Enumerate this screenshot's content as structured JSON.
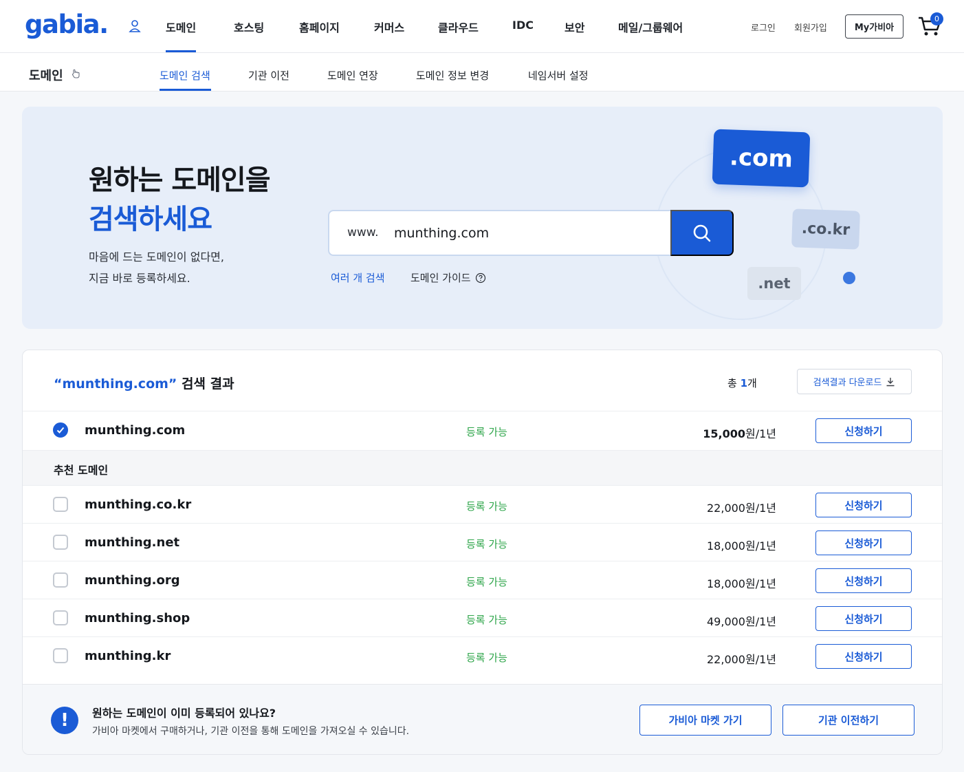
{
  "header": {
    "logo": "gabia.",
    "menu": [
      "도메인",
      "호스팅",
      "홈페이지",
      "커머스",
      "클라우드",
      "IDC",
      "보안",
      "메일/그룹웨어"
    ],
    "login": "로그인",
    "signup": "회원가입",
    "mygabia": "My가비아",
    "cart_count": "0"
  },
  "subnav": {
    "title": "도메인",
    "items": [
      "도메인 검색",
      "기관 이전",
      "도메인 연장",
      "도메인 정보 변경",
      "네임서버 설정"
    ]
  },
  "hero": {
    "title_line1": "원하는 도메인을",
    "title_line2": "검색하세요",
    "desc_line1": "마음에 드는 도메인이 없다면,",
    "desc_line2": "지금 바로 등록하세요.",
    "search_prefix": "www.",
    "search_value": "munthing.com",
    "multi_search": "여러 개 검색",
    "domain_guide": "도메인 가이드",
    "tags": [
      ".com",
      ".co.kr",
      ".net"
    ]
  },
  "results": {
    "query": "“munthing.com”",
    "heading_suffix": " 검색 결과",
    "total_prefix": "총 ",
    "total_count": "1",
    "total_suffix": "개",
    "download_label": "검색결과 다운로드",
    "main": {
      "domain": "munthing.com",
      "status": "등록 가능",
      "price": "15,000",
      "unit": "원/1년",
      "action": "신청하기",
      "checked": true
    },
    "recommended_title": "추천 도메인",
    "recommended": [
      {
        "domain": "munthing.co.kr",
        "status": "등록 가능",
        "price": "22,000",
        "unit": "원/1년",
        "action": "신청하기"
      },
      {
        "domain": "munthing.net",
        "status": "등록 가능",
        "price": "18,000",
        "unit": "원/1년",
        "action": "신청하기"
      },
      {
        "domain": "munthing.org",
        "status": "등록 가능",
        "price": "18,000",
        "unit": "원/1년",
        "action": "신청하기"
      },
      {
        "domain": "munthing.shop",
        "status": "등록 가능",
        "price": "49,000",
        "unit": "원/1년",
        "action": "신청하기"
      },
      {
        "domain": "munthing.kr",
        "status": "등록 가능",
        "price": "22,000",
        "unit": "원/1년",
        "action": "신청하기"
      }
    ]
  },
  "notice": {
    "title": "원하는 도메인이 이미 등록되어 있나요?",
    "desc": "가비아 마켓에서 구매하거나, 기관 이전을 통해 도메인을 가져오실 수 있습니다.",
    "market_button": "가비아 마켓 가기",
    "transfer_button": "기관 이전하기"
  },
  "colors": {
    "brand": "#1a5bd6",
    "available": "#2ea54a"
  }
}
